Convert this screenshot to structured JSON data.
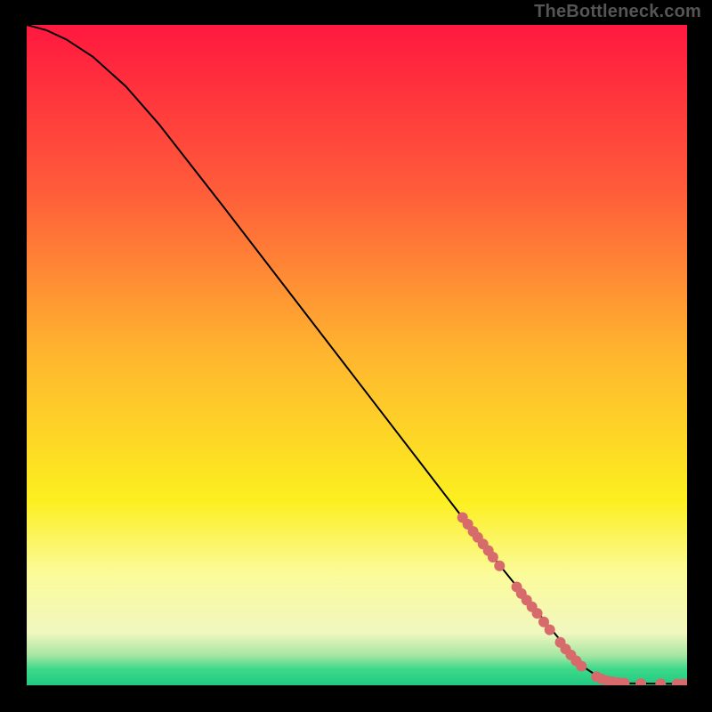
{
  "attribution": "TheBottleneck.com",
  "chart_data": {
    "type": "line",
    "title": "",
    "xlabel": "",
    "ylabel": "",
    "xlim": [
      0,
      100
    ],
    "ylim": [
      0,
      100
    ],
    "background_gradient": {
      "stops": [
        {
          "offset": 0.0,
          "color": "#ff183f"
        },
        {
          "offset": 0.25,
          "color": "#ff5c3a"
        },
        {
          "offset": 0.5,
          "color": "#ffb62f"
        },
        {
          "offset": 0.72,
          "color": "#fcef1f"
        },
        {
          "offset": 0.83,
          "color": "#fbfb99"
        },
        {
          "offset": 0.92,
          "color": "#f1f7bf"
        },
        {
          "offset": 0.955,
          "color": "#a5e6a3"
        },
        {
          "offset": 0.975,
          "color": "#3ed98a"
        },
        {
          "offset": 1.0,
          "color": "#1fca82"
        }
      ]
    },
    "series": [
      {
        "name": "bottleneck-curve",
        "stroke": "#000000",
        "points": [
          {
            "x": 0,
            "y": 100
          },
          {
            "x": 3,
            "y": 99.2
          },
          {
            "x": 6,
            "y": 97.8
          },
          {
            "x": 10,
            "y": 95.2
          },
          {
            "x": 15,
            "y": 90.7
          },
          {
            "x": 20,
            "y": 85.0
          },
          {
            "x": 30,
            "y": 72.2
          },
          {
            "x": 40,
            "y": 59.2
          },
          {
            "x": 50,
            "y": 46.2
          },
          {
            "x": 60,
            "y": 33.2
          },
          {
            "x": 70,
            "y": 20.2
          },
          {
            "x": 80,
            "y": 7.8
          },
          {
            "x": 84,
            "y": 3.0
          },
          {
            "x": 87,
            "y": 1.0
          },
          {
            "x": 90,
            "y": 0.3
          },
          {
            "x": 100,
            "y": 0.2
          }
        ]
      }
    ],
    "scatter": {
      "name": "highlight-dots",
      "color": "#d76a6a",
      "radius": 6,
      "points": [
        {
          "x": 66.0,
          "y": 25.4
        },
        {
          "x": 66.8,
          "y": 24.4
        },
        {
          "x": 67.6,
          "y": 23.3
        },
        {
          "x": 68.3,
          "y": 22.4
        },
        {
          "x": 69.1,
          "y": 21.4
        },
        {
          "x": 69.9,
          "y": 20.4
        },
        {
          "x": 70.6,
          "y": 19.4
        },
        {
          "x": 71.6,
          "y": 18.1
        },
        {
          "x": 74.2,
          "y": 14.9
        },
        {
          "x": 74.9,
          "y": 13.9
        },
        {
          "x": 75.7,
          "y": 12.9
        },
        {
          "x": 76.5,
          "y": 11.9
        },
        {
          "x": 77.3,
          "y": 10.9
        },
        {
          "x": 78.3,
          "y": 9.6
        },
        {
          "x": 79.2,
          "y": 8.4
        },
        {
          "x": 80.8,
          "y": 6.5
        },
        {
          "x": 81.6,
          "y": 5.5
        },
        {
          "x": 82.4,
          "y": 4.6
        },
        {
          "x": 83.2,
          "y": 3.7
        },
        {
          "x": 84.0,
          "y": 2.9
        },
        {
          "x": 86.3,
          "y": 1.3
        },
        {
          "x": 87.1,
          "y": 0.95
        },
        {
          "x": 88.0,
          "y": 0.65
        },
        {
          "x": 88.8,
          "y": 0.5
        },
        {
          "x": 89.6,
          "y": 0.4
        },
        {
          "x": 90.5,
          "y": 0.33
        },
        {
          "x": 93.0,
          "y": 0.26
        },
        {
          "x": 96.0,
          "y": 0.22
        },
        {
          "x": 98.5,
          "y": 0.2
        },
        {
          "x": 99.5,
          "y": 0.2
        }
      ]
    }
  }
}
